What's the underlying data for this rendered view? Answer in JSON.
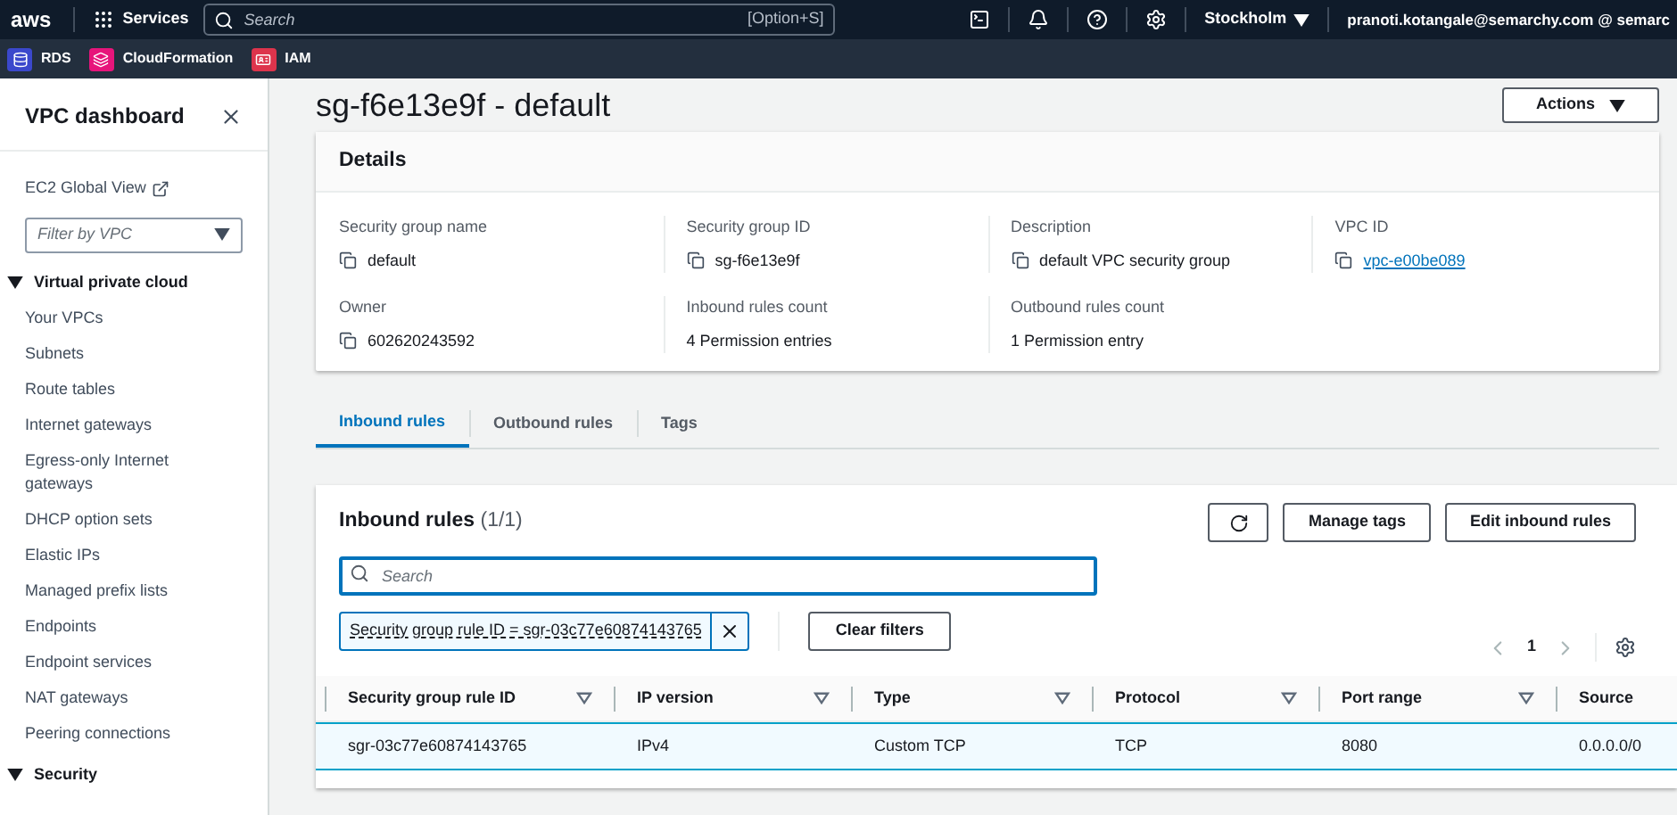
{
  "top_nav": {
    "logo": "aws",
    "services": "Services",
    "search": {
      "placeholder": "Search",
      "shortcut": "[Option+S]"
    },
    "region": "Stockholm",
    "account": "pranoti.kotangale@semarchy.com @ semarc"
  },
  "favorites": [
    {
      "label": "RDS",
      "color": "#3b48cc"
    },
    {
      "label": "CloudFormation",
      "color": "#e7157b"
    },
    {
      "label": "IAM",
      "color": "#dd344c"
    }
  ],
  "sidebar": {
    "title": "VPC dashboard",
    "global_view": "EC2 Global View",
    "filter": {
      "placeholder": "Filter by VPC"
    },
    "sections": [
      {
        "title": "Virtual private cloud",
        "expanded": true,
        "items": [
          "Your VPCs",
          "Subnets",
          "Route tables",
          "Internet gateways",
          "Egress-only Internet gateways",
          "DHCP option sets",
          "Elastic IPs",
          "Managed prefix lists",
          "Endpoints",
          "Endpoint services",
          "NAT gateways",
          "Peering connections"
        ]
      },
      {
        "title": "Security",
        "expanded": true
      }
    ]
  },
  "page": {
    "title": "sg-f6e13e9f - default",
    "actions": "Actions"
  },
  "details": {
    "title": "Details",
    "fields": [
      {
        "label": "Security group name",
        "value": "default",
        "copy": true,
        "link": false
      },
      {
        "label": "Security group ID",
        "value": "sg-f6e13e9f",
        "copy": true,
        "link": false
      },
      {
        "label": "Description",
        "value": "default VPC security group",
        "copy": true,
        "link": false
      },
      {
        "label": "VPC ID",
        "value": "vpc-e00be089",
        "copy": true,
        "link": true
      },
      {
        "label": "Owner",
        "value": "602620243592",
        "copy": true,
        "link": false
      },
      {
        "label": "Inbound rules count",
        "value": "4 Permission entries",
        "copy": false,
        "link": false
      },
      {
        "label": "Outbound rules count",
        "value": "1 Permission entry",
        "copy": false,
        "link": false
      }
    ]
  },
  "tabs": [
    {
      "label": "Inbound rules",
      "selected": true
    },
    {
      "label": "Outbound rules",
      "selected": false
    },
    {
      "label": "Tags",
      "selected": false
    }
  ],
  "rules": {
    "title": "Inbound rules",
    "count": "(1/1)",
    "buttons": [
      "Manage tags",
      "Edit inbound rules"
    ],
    "search": {
      "placeholder": "Search"
    },
    "filter_token": "Security group rule ID = sgr-03c77e60874143765",
    "clear_filters": "Clear filters",
    "page": "1",
    "columns": [
      "Security group rule ID",
      "IP version",
      "Type",
      "Protocol",
      "Port range",
      "Source"
    ],
    "rows": [
      {
        "selected": true,
        "cells": [
          "sgr-03c77e60874143765",
          "IPv4",
          "Custom TCP",
          "TCP",
          "8080",
          "0.0.0.0/0"
        ]
      }
    ]
  }
}
